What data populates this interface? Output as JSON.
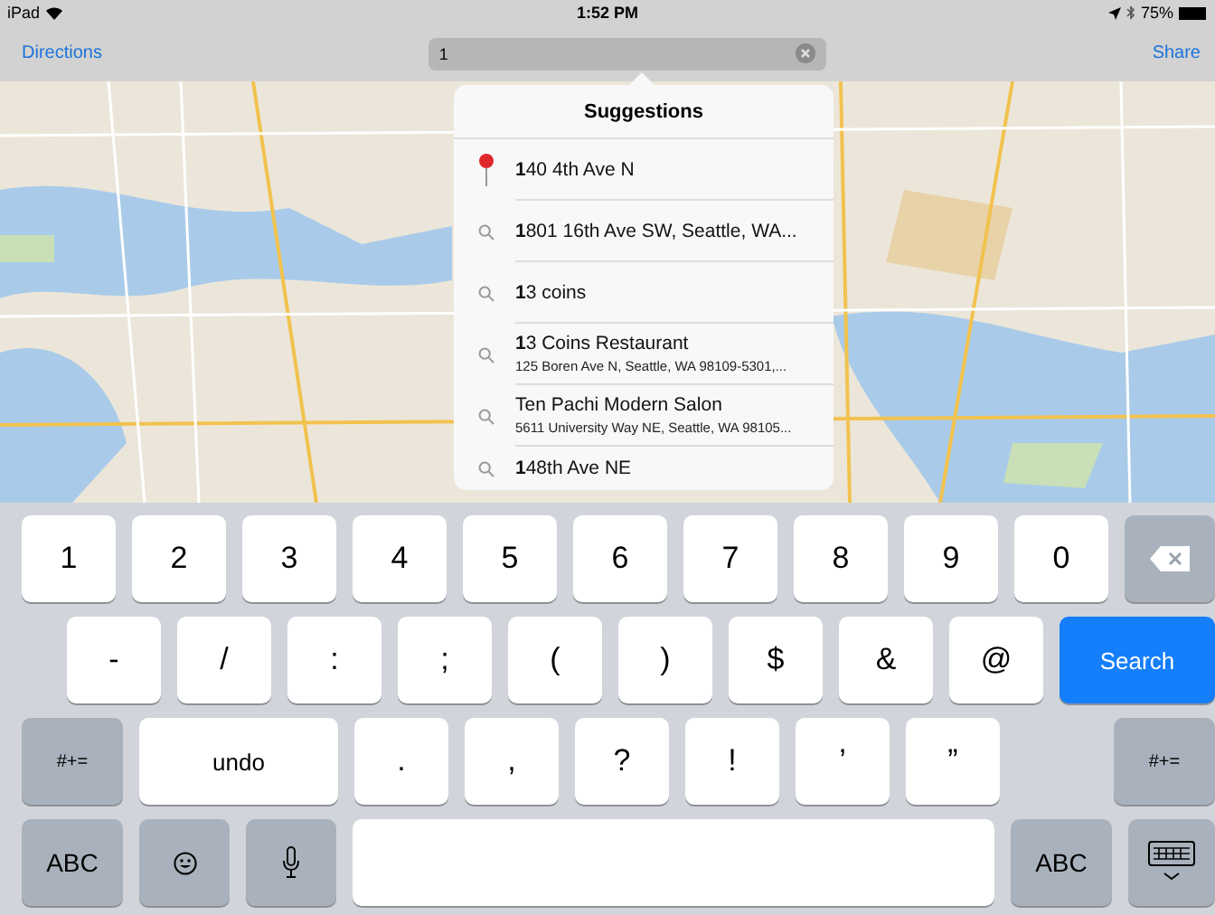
{
  "status_bar": {
    "device": "iPad",
    "time": "1:52 PM",
    "battery": "75%"
  },
  "nav_bar": {
    "left_button": "Directions",
    "search": {
      "value": "1"
    },
    "right_button": "Share"
  },
  "suggestions": {
    "title": "Suggestions",
    "items": [
      {
        "kind": "pin",
        "title": "**1**40 4th Ave N"
      },
      {
        "kind": "search",
        "title": "**1**801 16th Ave SW, Seattle, WA..."
      },
      {
        "kind": "search",
        "title": "**1**3 coins"
      },
      {
        "kind": "search",
        "title": "**1**3 Coins Restaurant",
        "subtitle": "125 Boren Ave N, Seattle, WA  98109-5301,..."
      },
      {
        "kind": "search",
        "title": "Ten Pachi Modern Salon",
        "subtitle": "5611 University Way NE, Seattle, WA  98105..."
      },
      {
        "kind": "search",
        "title": "**1**48th Ave NE"
      }
    ]
  },
  "keyboard": {
    "rows": [
      [
        {
          "kind": "char",
          "label": "1"
        },
        {
          "kind": "char",
          "label": "2"
        },
        {
          "kind": "char",
          "label": "3"
        },
        {
          "kind": "char",
          "label": "4"
        },
        {
          "kind": "char",
          "label": "5"
        },
        {
          "kind": "char",
          "label": "6"
        },
        {
          "kind": "char",
          "label": "7"
        },
        {
          "kind": "char",
          "label": "8"
        },
        {
          "kind": "char",
          "label": "9"
        },
        {
          "kind": "char",
          "label": "0"
        },
        {
          "kind": "delete"
        }
      ],
      [
        {
          "kind": "char",
          "label": "-"
        },
        {
          "kind": "char",
          "label": "/"
        },
        {
          "kind": "char",
          "label": ":"
        },
        {
          "kind": "char",
          "label": ";"
        },
        {
          "kind": "char",
          "label": "("
        },
        {
          "kind": "char",
          "label": ")"
        },
        {
          "kind": "char",
          "label": "$"
        },
        {
          "kind": "char",
          "label": "&"
        },
        {
          "kind": "char",
          "label": "@"
        },
        {
          "kind": "search",
          "label": "Search"
        }
      ],
      [
        {
          "kind": "mode",
          "label": "#+="
        },
        {
          "kind": "undo",
          "label": "undo"
        },
        {
          "kind": "char",
          "label": "."
        },
        {
          "kind": "char",
          "label": ","
        },
        {
          "kind": "char",
          "label": "?"
        },
        {
          "kind": "char",
          "label": "!"
        },
        {
          "kind": "char",
          "label": "’"
        },
        {
          "kind": "char",
          "label": "”"
        },
        {
          "kind": "mode",
          "label": "#+="
        }
      ],
      [
        {
          "kind": "mode",
          "label": "ABC"
        },
        {
          "kind": "emoji"
        },
        {
          "kind": "mic"
        },
        {
          "kind": "space"
        },
        {
          "kind": "mode",
          "label": "ABC"
        },
        {
          "kind": "dismiss"
        }
      ]
    ]
  }
}
